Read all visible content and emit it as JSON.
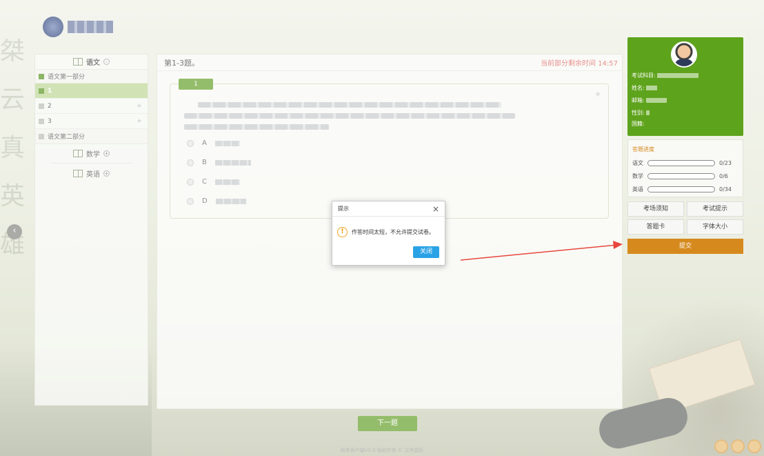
{
  "background": {
    "calligraphy": [
      "桀",
      "云",
      "真",
      "英",
      "雄"
    ]
  },
  "sidebar": {
    "subjects": [
      {
        "title": "语文",
        "toggle": "-"
      },
      {
        "title": "数学",
        "toggle": "+"
      },
      {
        "title": "英语",
        "toggle": "+"
      }
    ],
    "part1_label": "语文第一部分",
    "questions": [
      {
        "label": "1",
        "active": true
      },
      {
        "label": "2",
        "active": false
      },
      {
        "label": "3",
        "active": false
      }
    ],
    "part2_label": "语文第二部分"
  },
  "main": {
    "title": "第1-3题。",
    "timer_text": "当前部分剩余时间 14:57",
    "question_tab": "1",
    "options": [
      "A",
      "B",
      "C",
      "D"
    ],
    "next_button": "下一题"
  },
  "footer_text": "网考客户端V3.0 版权所有 © 汉考国际",
  "profile": {
    "subject_label": "考试科目:",
    "name_label": "姓名:",
    "email_label": "邮箱:",
    "gender_label": "性别:",
    "country_label": "国籍:"
  },
  "progress": {
    "title": "答题进度",
    "rows": [
      {
        "label": "语文",
        "count": "0/23",
        "fraction": 0
      },
      {
        "label": "数学",
        "count": "0/6",
        "fraction": 0
      },
      {
        "label": "英语",
        "count": "0/34",
        "fraction": 0
      }
    ]
  },
  "actions": {
    "exam_notice": "考场须知",
    "exam_tips": "考试提示",
    "answer_card": "答题卡",
    "font_size": "字体大小",
    "submit": "提交"
  },
  "modal": {
    "title": "提示",
    "close_icon": "×",
    "warning_icon": "!",
    "message": "作答时间太短，不允许提交试卷。",
    "close_button": "关闭"
  },
  "colors": {
    "brand_green": "#5ea31c",
    "submit_orange": "#d68a1e",
    "timer_red": "#d9534f",
    "modal_button_blue": "#2aa2e6",
    "annotation_arrow": "#e8463d"
  }
}
